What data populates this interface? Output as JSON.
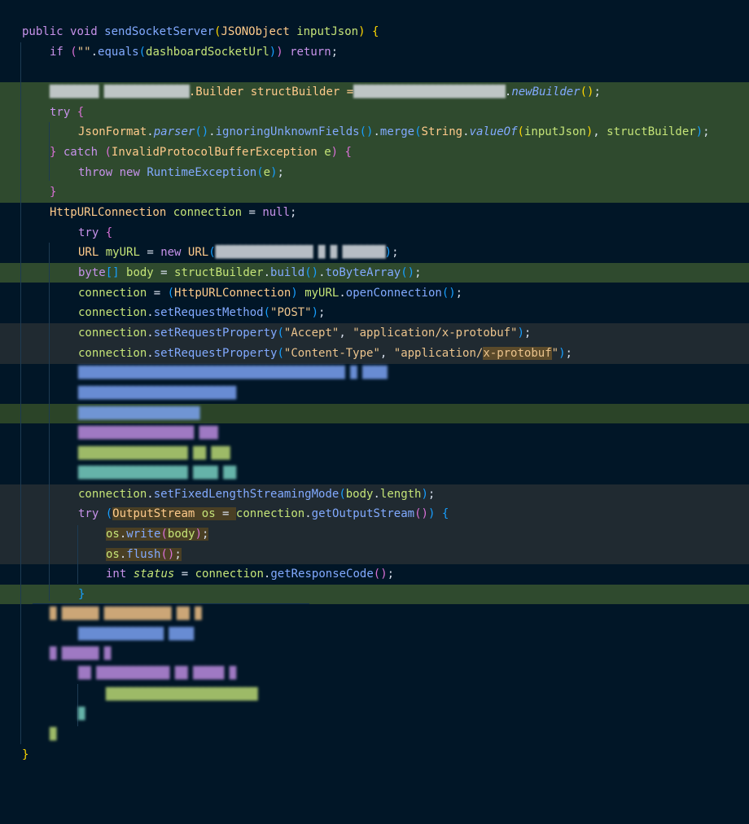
{
  "editor": {
    "theme_bg": "#011627",
    "accent_green_highlight": "#2f4a2e",
    "accent_gray_highlight": "#202a31",
    "lines": {
      "l1_kw_public": "public",
      "l1_kw_void": "void",
      "l1_method": "sendSocketServer",
      "l1_type": "JSONObject",
      "l1_param": "inputJson",
      "l2_if": "if",
      "l2_string": "\"\"",
      "l2_equals": "equals",
      "l2_arg": "dashboardSocketUrl",
      "l2_return": "return",
      "l4_redacted_a": "████████ ██████████████",
      "l4_builder": ".Builder structBuilder =",
      "l4_redacted_b": "█████████████████████████",
      "l4_newbuilder": "newBuilder",
      "l5_try": "try",
      "l6_jsonformat": "JsonFormat",
      "l6_parser": "parser",
      "l6_ignoring": "ignoringUnknownFields",
      "l6_merge": "merge",
      "l6_string": "String",
      "l6_valueof": "valueOf",
      "l6_arg1": "inputJson",
      "l6_arg2": "structBuilder",
      "l7_catch": "catch",
      "l7_exc": "InvalidProtocolBufferException",
      "l7_e": "e",
      "l8_throw": "throw",
      "l8_new": "new",
      "l8_runtime": "RuntimeException",
      "l8_e": "e",
      "l10_type": "HttpURLConnection",
      "l10_var": "connection",
      "l10_null": "null",
      "l11_try": "try",
      "l12_url": "URL",
      "l12_var": "myURL",
      "l12_new": "new",
      "l12_url2": "URL",
      "l12_redacted": "████████████████ █ █ ███████",
      "l13_byte": "byte",
      "l13_var": "body",
      "l13_sb": "structBuilder",
      "l13_build": "build",
      "l13_tobytes": "toByteArray",
      "l14_conn": "connection",
      "l14_cast": "HttpURLConnection",
      "l14_myurl": "myURL",
      "l14_open": "openConnection",
      "l15_conn": "connection",
      "l15_method": "setRequestMethod",
      "l15_post": "\"POST\"",
      "l16_conn": "connection",
      "l16_method": "setRequestProperty",
      "l16_a1": "\"Accept\"",
      "l16_a2": "\"application/x-protobuf\"",
      "l17_conn": "connection",
      "l17_method": "setRequestProperty",
      "l17_a1": "\"Content-Type\"",
      "l17_a2_pre": "\"application/",
      "l17_a2_hl": "x-protobuf",
      "l17_a2_post": "\"",
      "r18": "████████████████████████████████████████████ █ ████",
      "r19": "██████████████████████████",
      "r20": "████████████████████",
      "r21": "███████████████████ ███",
      "r22": "██████████████████ ██ ███",
      "r23": "██████████████████ ████ ██",
      "l24_conn": "connection",
      "l24_method": "setFixedLengthStreamingMode",
      "l24_body": "body",
      "l24_length": "length",
      "l25_try": "try",
      "l25_os_type": "OutputStream",
      "l25_os": "os",
      "l25_conn": "connection",
      "l25_get": "getOutputStream",
      "l26_os": "os",
      "l26_write": "write",
      "l26_body": "body",
      "l27_os": "os",
      "l27_flush": "flush",
      "l28_int": "int",
      "l28_status": "status",
      "l28_conn": "connection",
      "l28_get": "getResponseCode",
      "r30": "█ ██████ ███████████ ██ █",
      "r31": "██████████████ ████",
      "r32": "█ ██████ █",
      "r33": "██ ████████████ ██ █████ █",
      "r34": "█████████████████████████",
      "r35": "█",
      "r36": "█"
    }
  }
}
